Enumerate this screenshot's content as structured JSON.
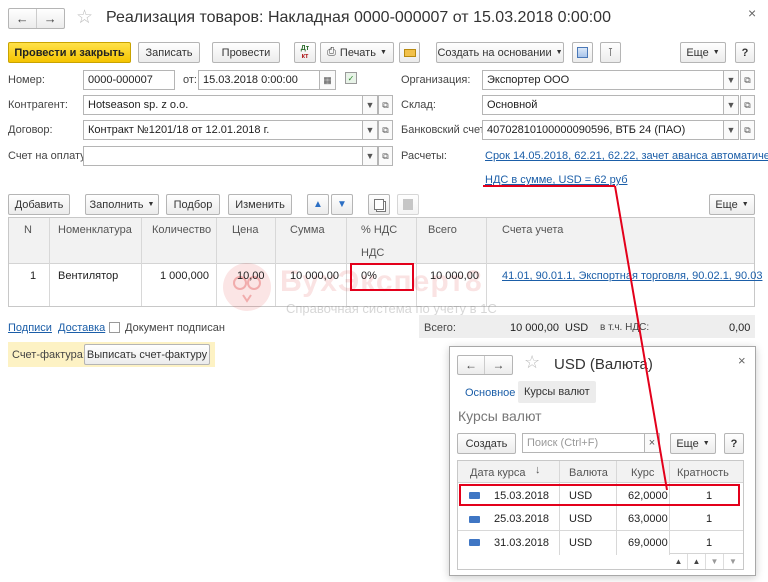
{
  "title": "Реализация товаров: Накладная 0000-000007 от 15.03.2018 0:00:00",
  "toolbar": {
    "post_close": "Провести и закрыть",
    "save": "Записать",
    "post": "Провести",
    "dt_kt": "Дт\nкт",
    "print": "Печать",
    "create_based": "Создать на основании",
    "more": "Еще",
    "help": "?"
  },
  "fields": {
    "number_label": "Номер:",
    "number_value": "0000-000007",
    "from_label": "от:",
    "date_value": "15.03.2018  0:00:00",
    "org_label": "Организация:",
    "org_value": "Экспортер ООО",
    "counterparty_label": "Контрагент:",
    "counterparty_value": "Hotseason sp. z o.o.",
    "warehouse_label": "Склад:",
    "warehouse_value": "Основной",
    "contract_label": "Договор:",
    "contract_value": "Контракт №1201/18 от 12.01.2018 г.",
    "bank_label": "Банковский счет:",
    "bank_value": "40702810100000090596, ВТБ 24 (ПАО)",
    "invoice_label": "Счет на оплату:",
    "invoice_value": "",
    "settlements_label": "Расчеты:",
    "settlements_link": "Срок 14.05.2018, 62.21, 62.22, зачет аванса автоматически",
    "vat_link": "НДС в сумме, USD = 62 руб"
  },
  "table_toolbar": {
    "add": "Добавить",
    "fill": "Заполнить",
    "select": "Подбор",
    "change": "Изменить",
    "more": "Еще"
  },
  "table": {
    "headers": {
      "n": "N",
      "item": "Номенклатура",
      "qty": "Количество",
      "price": "Цена",
      "sum": "Сумма",
      "vat_rate": "% НДС",
      "vat": "НДС",
      "total": "Всего",
      "accounts": "Счета учета"
    },
    "row": {
      "n": "1",
      "item": "Вентилятор",
      "qty": "1 000,000",
      "price": "10,00",
      "sum": "10 000,00",
      "vat_rate": "0%",
      "total": "10 000,00",
      "accounts": "41.01, 90.01.1, Экспортная торговля, 90.02.1, 90.03"
    }
  },
  "watermark": {
    "brand": "БухЭксперт8",
    "tagline": "Справочная система по учету в 1С"
  },
  "footer": {
    "signatures": "Подписи",
    "delivery": "Доставка",
    "doc_signed": "Документ подписан",
    "total_label": "Всего:",
    "total_value": "10 000,00",
    "currency": "USD",
    "vat_incl_label": "в т.ч. НДС:",
    "vat_value": "0,00",
    "invoice_label": "Счет-фактура:",
    "issue_invoice": "Выписать счет-фактуру"
  },
  "popup": {
    "title": "USD (Валюта)",
    "tab_main": "Основное",
    "tab_rates": "Курсы валют",
    "section_title": "Курсы валют",
    "create": "Создать",
    "search_placeholder": "Поиск (Ctrl+F)",
    "more": "Еще",
    "help": "?",
    "headers": {
      "date": "Дата курса",
      "currency": "Валюта",
      "rate": "Курс",
      "multiplicity": "Кратность"
    },
    "rows": [
      {
        "date": "15.03.2018",
        "currency": "USD",
        "rate": "62,0000",
        "multiplicity": "1"
      },
      {
        "date": "25.03.2018",
        "currency": "USD",
        "rate": "63,0000",
        "multiplicity": "1"
      },
      {
        "date": "31.03.2018",
        "currency": "USD",
        "rate": "69,0000",
        "multiplicity": "1"
      }
    ]
  },
  "colors": {
    "accent_yellow": "#f5c400",
    "highlight_red": "#e3001b",
    "link_blue": "#1b5ea8"
  }
}
